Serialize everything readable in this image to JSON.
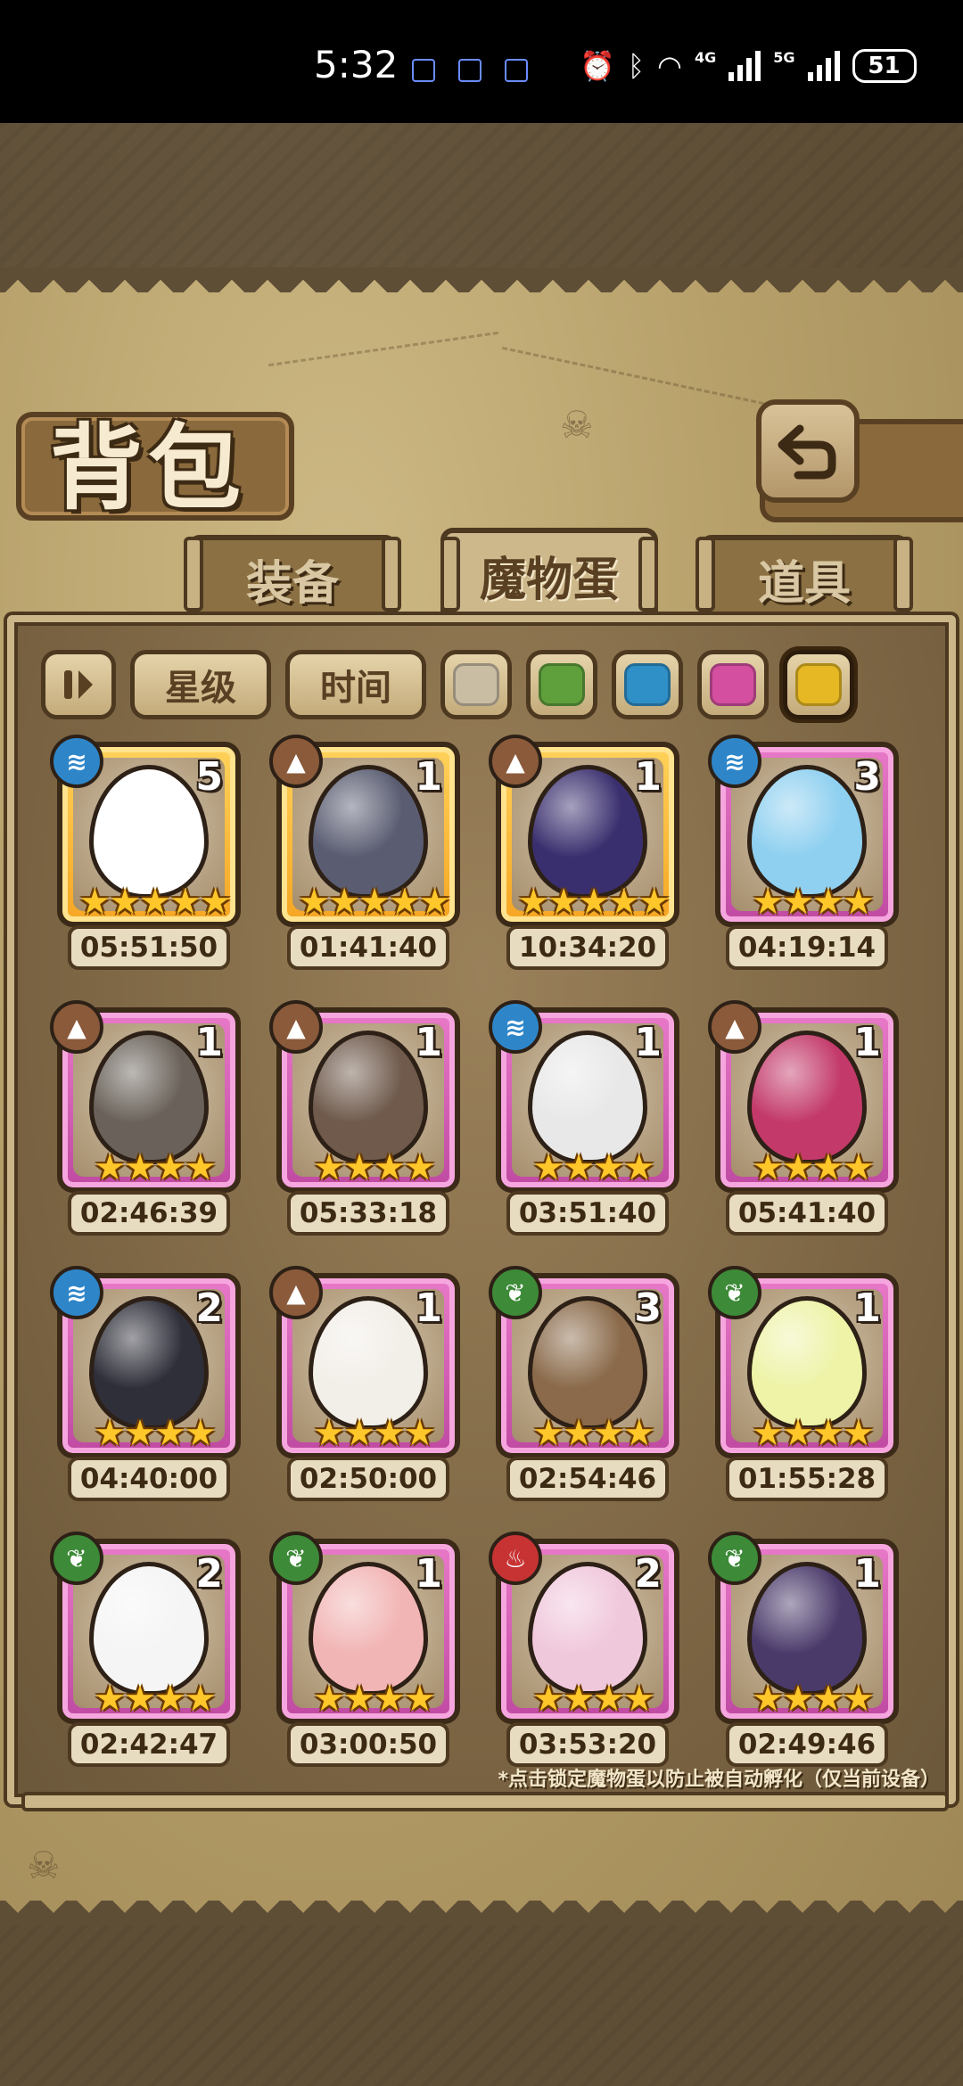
{
  "status_bar": {
    "time": "5:32",
    "net_4g": "4G",
    "net_5g": "5G",
    "battery": "51"
  },
  "title": "背包",
  "tabs": [
    {
      "label": "装备",
      "active": false
    },
    {
      "label": "魔物蛋",
      "active": true
    },
    {
      "label": "道具",
      "active": false
    }
  ],
  "filters": {
    "star_label": "星级",
    "time_label": "时间",
    "rarity_colors": [
      "#c9bda4",
      "#5fa03c",
      "#2f8fc7",
      "#d44fa0",
      "#e6b823"
    ],
    "selected_rarity": 4
  },
  "eggs": [
    {
      "count": "5",
      "stars": "★★★★★",
      "timer": "05:51:50",
      "frame": "gold",
      "element": "water",
      "egg_color": "#ffffff"
    },
    {
      "count": "1",
      "stars": "★★★★★",
      "timer": "01:41:40",
      "frame": "gold",
      "element": "rock",
      "egg_color": "#5a5d72"
    },
    {
      "count": "1",
      "stars": "★★★★★",
      "timer": "10:34:20",
      "frame": "gold",
      "element": "rock",
      "egg_color": "#3a2f6e"
    },
    {
      "count": "3",
      "stars": "★★★★",
      "timer": "04:19:14",
      "frame": "pink",
      "element": "water",
      "egg_color": "#8fd0f0"
    },
    {
      "count": "1",
      "stars": "★★★★",
      "timer": "02:46:39",
      "frame": "pink",
      "element": "rock",
      "egg_color": "#6a625a"
    },
    {
      "count": "1",
      "stars": "★★★★",
      "timer": "05:33:18",
      "frame": "pink",
      "element": "rock",
      "egg_color": "#6f5a4c"
    },
    {
      "count": "1",
      "stars": "★★★★",
      "timer": "03:51:40",
      "frame": "pink",
      "element": "water",
      "egg_color": "#e8e8e8"
    },
    {
      "count": "1",
      "stars": "★★★★",
      "timer": "05:41:40",
      "frame": "pink",
      "element": "rock",
      "egg_color": "#c33a6a"
    },
    {
      "count": "2",
      "stars": "★★★★",
      "timer": "04:40:00",
      "frame": "pink",
      "element": "water",
      "egg_color": "#2f2f3a"
    },
    {
      "count": "1",
      "stars": "★★★★",
      "timer": "02:50:00",
      "frame": "pink",
      "element": "rock",
      "egg_color": "#f2eee8"
    },
    {
      "count": "3",
      "stars": "★★★★",
      "timer": "02:54:46",
      "frame": "pink",
      "element": "leaf",
      "egg_color": "#8a6a4a"
    },
    {
      "count": "1",
      "stars": "★★★★",
      "timer": "01:55:28",
      "frame": "pink",
      "element": "leaf",
      "egg_color": "#eef3a8"
    },
    {
      "count": "2",
      "stars": "★★★★",
      "timer": "02:42:47",
      "frame": "pink",
      "element": "leaf",
      "egg_color": "#f5f5f5"
    },
    {
      "count": "1",
      "stars": "★★★★",
      "timer": "03:00:50",
      "frame": "pink",
      "element": "leaf",
      "egg_color": "#f2b5b5"
    },
    {
      "count": "2",
      "stars": "★★★★",
      "timer": "03:53:20",
      "frame": "pink",
      "element": "fire",
      "egg_color": "#f0c8dc"
    },
    {
      "count": "1",
      "stars": "★★★★",
      "timer": "02:49:46",
      "frame": "pink",
      "element": "leaf",
      "egg_color": "#4a3a6a"
    }
  ],
  "element_glyphs": {
    "water": "≋",
    "rock": "▲",
    "leaf": "❦",
    "fire": "♨"
  },
  "footnote": "*点击锁定魔物蛋以防止被自动孵化（仅当前设备）"
}
